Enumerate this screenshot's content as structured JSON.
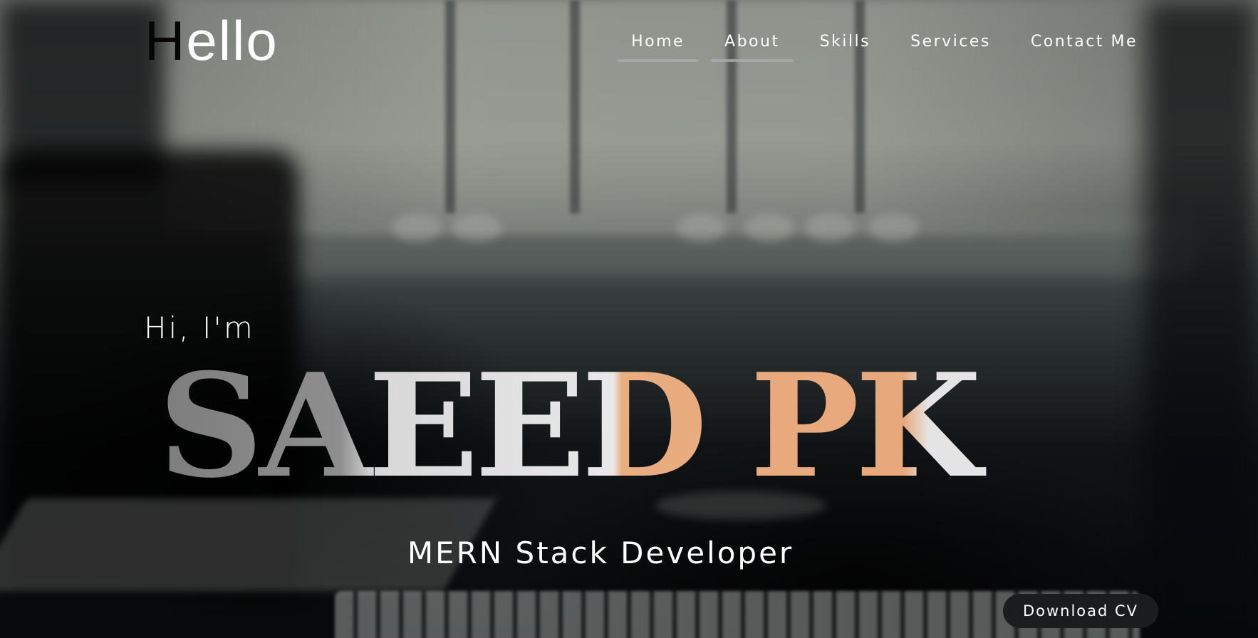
{
  "header": {
    "logo_first_letter": "H",
    "logo_rest": "ello",
    "nav": [
      {
        "label": "Home",
        "underlined": true
      },
      {
        "label": "About",
        "underlined": true
      },
      {
        "label": "Skills",
        "underlined": false
      },
      {
        "label": "Services",
        "underlined": false
      },
      {
        "label": "Contact Me",
        "underlined": false
      }
    ]
  },
  "hero": {
    "greeting": "Hi, I'm",
    "name": "SAEED PK",
    "role": "MERN Stack Developer",
    "cta_label": "Download CV"
  },
  "colors": {
    "accent_peach": "#e9ad80",
    "letter_light": "#e6e6e6",
    "letter_grey": "#8a8a8a",
    "button_bg": "#1b1c1d"
  }
}
